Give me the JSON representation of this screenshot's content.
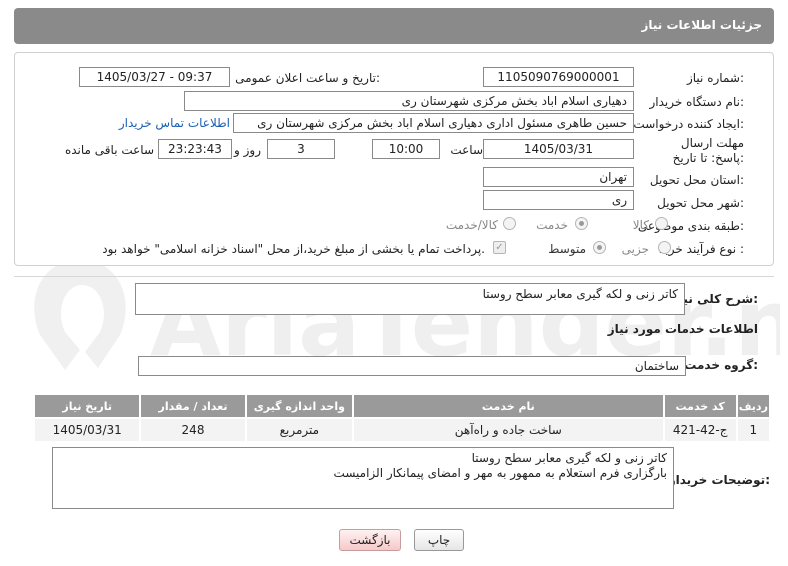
{
  "header": {
    "title": "جزئیات اطلاعات نیاز"
  },
  "form": {
    "need_number_label": "شماره نیاز:",
    "need_number": "1105090769000001",
    "announce_label": "تاریخ و ساعت اعلان عمومی:",
    "announce_value": "1405/03/27 - 09:37",
    "buyer_org_label": "نام دستگاه خریدار:",
    "buyer_org": "دهیاری اسلام اباد بخش مرکزی شهرستان ری",
    "creator_label": "ایجاد کننده درخواست:",
    "creator": "حسین طاهری مسئول اداری دهیاری اسلام اباد بخش مرکزی شهرستان ری",
    "contact_link": "اطلاعات تماس خریدار",
    "deadline_label": "مهلت ارسال پاسخ: تا تاریخ:",
    "deadline_date": "1405/03/31",
    "time_label": "ساعت",
    "deadline_time": "10:00",
    "days_value": "3",
    "days_label": "روز و",
    "remaining_time": "23:23:43",
    "remaining_label": "ساعت باقی مانده",
    "province_label": "استان محل تحویل:",
    "province": "تهران",
    "city_label": "شهر محل تحویل:",
    "city": "ری",
    "category_label": "طبقه بندی موضوعی:",
    "category_options": [
      "کالا",
      "خدمت",
      "کالا/خدمت"
    ],
    "purchase_type_label": "نوع فرآیند خرید :",
    "purchase_options": [
      "جزیی",
      "متوسط"
    ],
    "payment_note": "پرداخت تمام یا بخشی از مبلغ خرید،از محل \"اسناد خزانه اسلامی\" خواهد بود."
  },
  "summary": {
    "label": "شرح کلی نیاز:",
    "value": "کاتر زنی و لکه گیری معابر سطح روستا"
  },
  "services": {
    "section_title": "اطلاعات خدمات مورد نیاز",
    "group_label": "گروه خدمت:",
    "group_value": "ساختمان",
    "columns": [
      "ردیف",
      "کد خدمت",
      "نام خدمت",
      "واحد اندازه گیری",
      "تعداد / مقدار",
      "تاریخ نیاز"
    ],
    "rows": [
      [
        "1",
        "ج-42-421",
        "ساخت جاده و راه‌آهن",
        "مترمربع",
        "248",
        "1405/03/31"
      ]
    ]
  },
  "buyer_notes": {
    "label": "توضیحات خریدار:",
    "line1": "کاتر زنی و لکه گیری معابر سطح روستا",
    "line2": "بارگزاری فرم استعلام به ممهور به مهر و امضای پیمانکار الزامیست"
  },
  "buttons": {
    "print": "چاپ",
    "back": "بازگشت"
  },
  "watermark": {
    "text": "AriaTender.net"
  },
  "colors": {
    "header_bg": "#8a8a8a",
    "table_header_bg": "#9a9a9a",
    "link": "#1a5fb4",
    "back_button": "#f5c9c9"
  }
}
